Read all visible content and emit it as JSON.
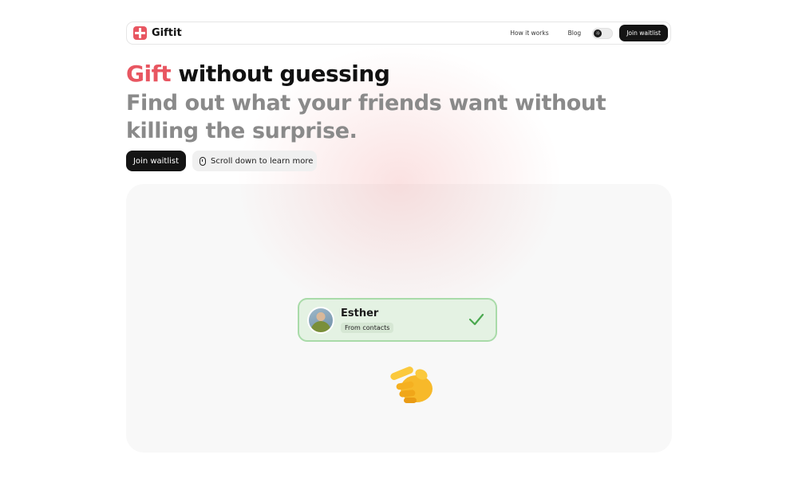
{
  "nav": {
    "brand_name": "Giftit",
    "links": [
      "How it works",
      "Blog"
    ],
    "cta_label": "Join waitlist",
    "theme_icon": "sun-icon"
  },
  "hero": {
    "title_accent": "Gift",
    "title_rest": "without guessing",
    "subtitle": "Find out what your friends want without killing the surprise.",
    "primary_button": "Join waitlist",
    "secondary_button": "Scroll down to learn more",
    "secondary_icon": "mouse-icon"
  },
  "demo": {
    "contact": {
      "name": "Esther",
      "source": "From contacts",
      "status_icon": "checkmark-icon"
    },
    "pointer_icon": "pointing-hand-icon"
  },
  "colors": {
    "accent": "#e85661",
    "dark": "#141414",
    "muted_text": "#8a8a8a",
    "card_green": "#e4f2e3",
    "card_border": "#a9dba9",
    "check_green": "#4aa84f"
  }
}
